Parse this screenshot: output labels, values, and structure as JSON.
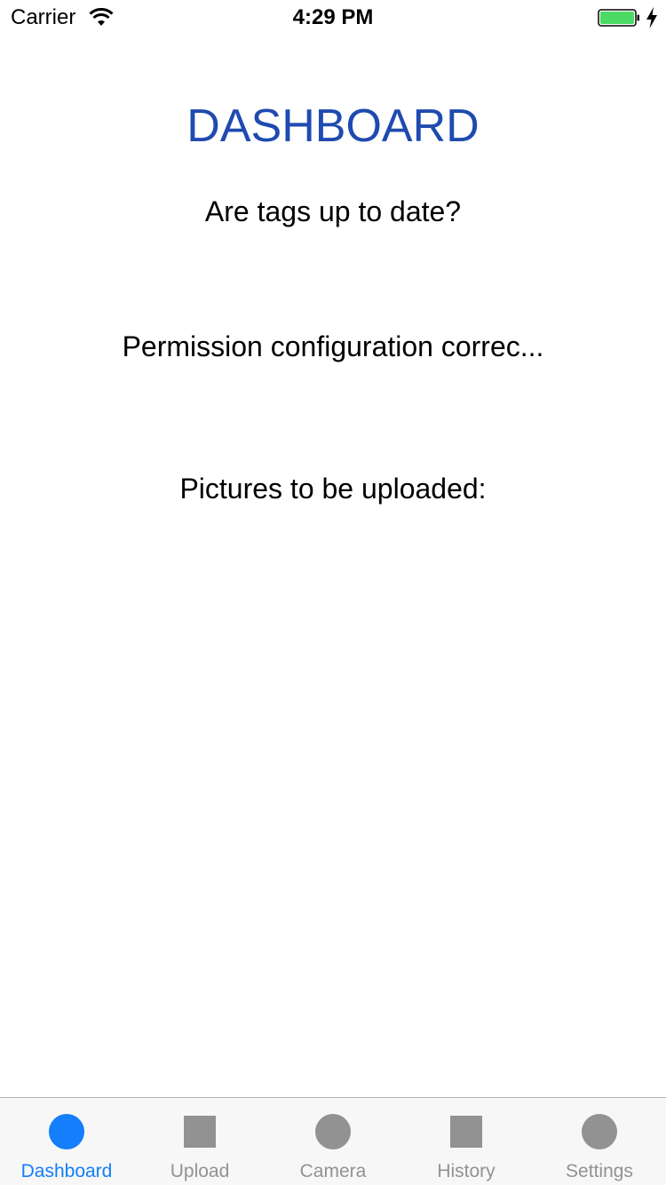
{
  "status_bar": {
    "carrier": "Carrier",
    "time": "4:29 PM",
    "battery_icon": "battery-icon",
    "wifi_icon": "wifi-icon"
  },
  "dashboard": {
    "title": "DASHBOARD",
    "tags_question": "Are tags up to date?",
    "permission_status": "Permission configuration correc...",
    "pictures_label": "Pictures to be uploaded:"
  },
  "tab_bar": {
    "tabs": [
      {
        "label": "Dashboard",
        "icon": "circle",
        "active": true
      },
      {
        "label": "Upload",
        "icon": "square",
        "active": false
      },
      {
        "label": "Camera",
        "icon": "circle",
        "active": false
      },
      {
        "label": "History",
        "icon": "square",
        "active": false
      },
      {
        "label": "Settings",
        "icon": "circle",
        "active": false
      }
    ]
  },
  "colors": {
    "title": "#1f4ab0",
    "tab_active": "#147efb",
    "tab_inactive": "#929292",
    "battery": "#4cd964"
  }
}
